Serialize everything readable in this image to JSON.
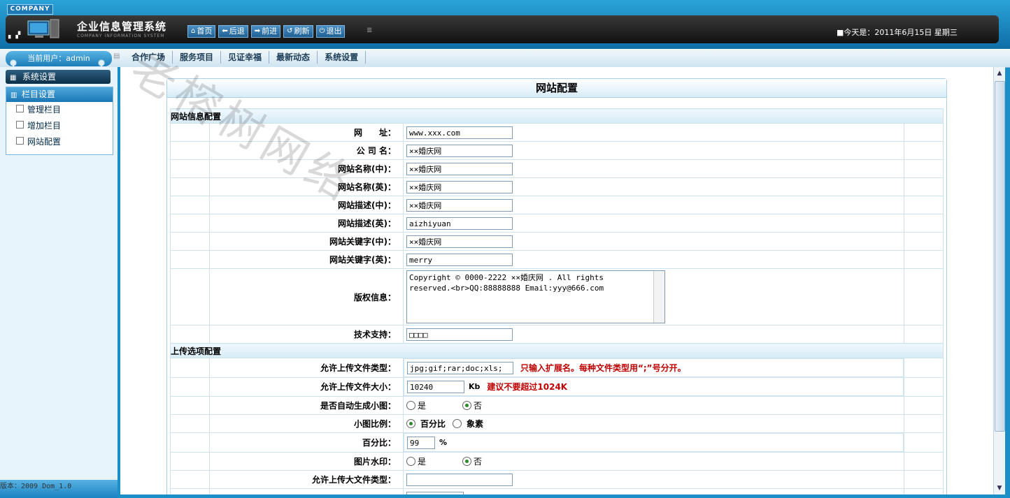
{
  "header": {
    "company_badge": "COMPANY",
    "title": "企业信息管理系统",
    "subtitle": "COMPANY INFORMATION SYSTEM",
    "nav": [
      {
        "label": "首页",
        "icon": "home-icon",
        "glyph": "⌂"
      },
      {
        "label": "后退",
        "icon": "back-arrow-icon",
        "glyph": "⬅"
      },
      {
        "label": "前进",
        "icon": "forward-arrow-icon",
        "glyph": "➡"
      },
      {
        "label": "刷新",
        "icon": "refresh-icon",
        "glyph": "↺"
      },
      {
        "label": "退出",
        "icon": "power-icon",
        "glyph": "⏻"
      }
    ],
    "date_text": "■今天是：2011年6月15日 星期三"
  },
  "user_box": "当前用户：admin",
  "tabs": [
    "合作广场",
    "服务项目",
    "见证幸福",
    "最新动态",
    "系统设置"
  ],
  "sidebar": {
    "header": "系统设置",
    "section": "栏目设置",
    "items": [
      "管理栏目",
      "增加栏目",
      "网站配置"
    ],
    "version": "版本：2009 Dom_1.0"
  },
  "watermark": "老榕树网络",
  "form": {
    "title": "网站配置",
    "section1": "网站信息配置",
    "rows": [
      {
        "label": "网　　址：",
        "value": "www.xxx.com"
      },
      {
        "label": "公 司 名：",
        "value": "××婚庆网"
      },
      {
        "label": "网站名称(中)：",
        "value": "××婚庆网"
      },
      {
        "label": "网站名称(英)：",
        "value": "××婚庆网"
      },
      {
        "label": "网站描述(中)：",
        "value": "××婚庆网"
      },
      {
        "label": "网站描述(英)：",
        "value": "aizhiyuan"
      },
      {
        "label": "网站关键字(中)：",
        "value": "××婚庆网"
      },
      {
        "label": "网站关键字(英)：",
        "value": "merry"
      }
    ],
    "copyright_label": "版权信息：",
    "copyright_value": "Copyright © 0000-2222 ××婚庆网 . All rights\nreserved.<br>QQ:88888888 Email:yyy@666.com",
    "tech_label": "技术支持：",
    "tech_value": "□□□□",
    "section2": "上传选项配置",
    "upload_types_label": "允许上传文件类型：",
    "upload_types_value": "jpg;gif;rar;doc;xls;",
    "upload_types_hint": "只输入扩展名。每种文件类型用“;”号分开。",
    "upload_size_label": "允许上传文件大小：",
    "upload_size_value": "10240",
    "upload_size_unit": "Kb",
    "upload_size_hint": "建议不要超过1024K",
    "thumb_label": "是否自动生成小图：",
    "thumb_yes": "是",
    "thumb_no": "否",
    "ratio_label": "小图比例：",
    "ratio_pct": "百分比",
    "ratio_px": "象素",
    "pct_label": "百分比：",
    "pct_value": "99",
    "pct_unit": "%",
    "wm_label": "图片水印：",
    "wm_yes": "是",
    "wm_no": "否",
    "bigfile_label": "允许上传大文件类型：",
    "bigfile_value": ""
  }
}
